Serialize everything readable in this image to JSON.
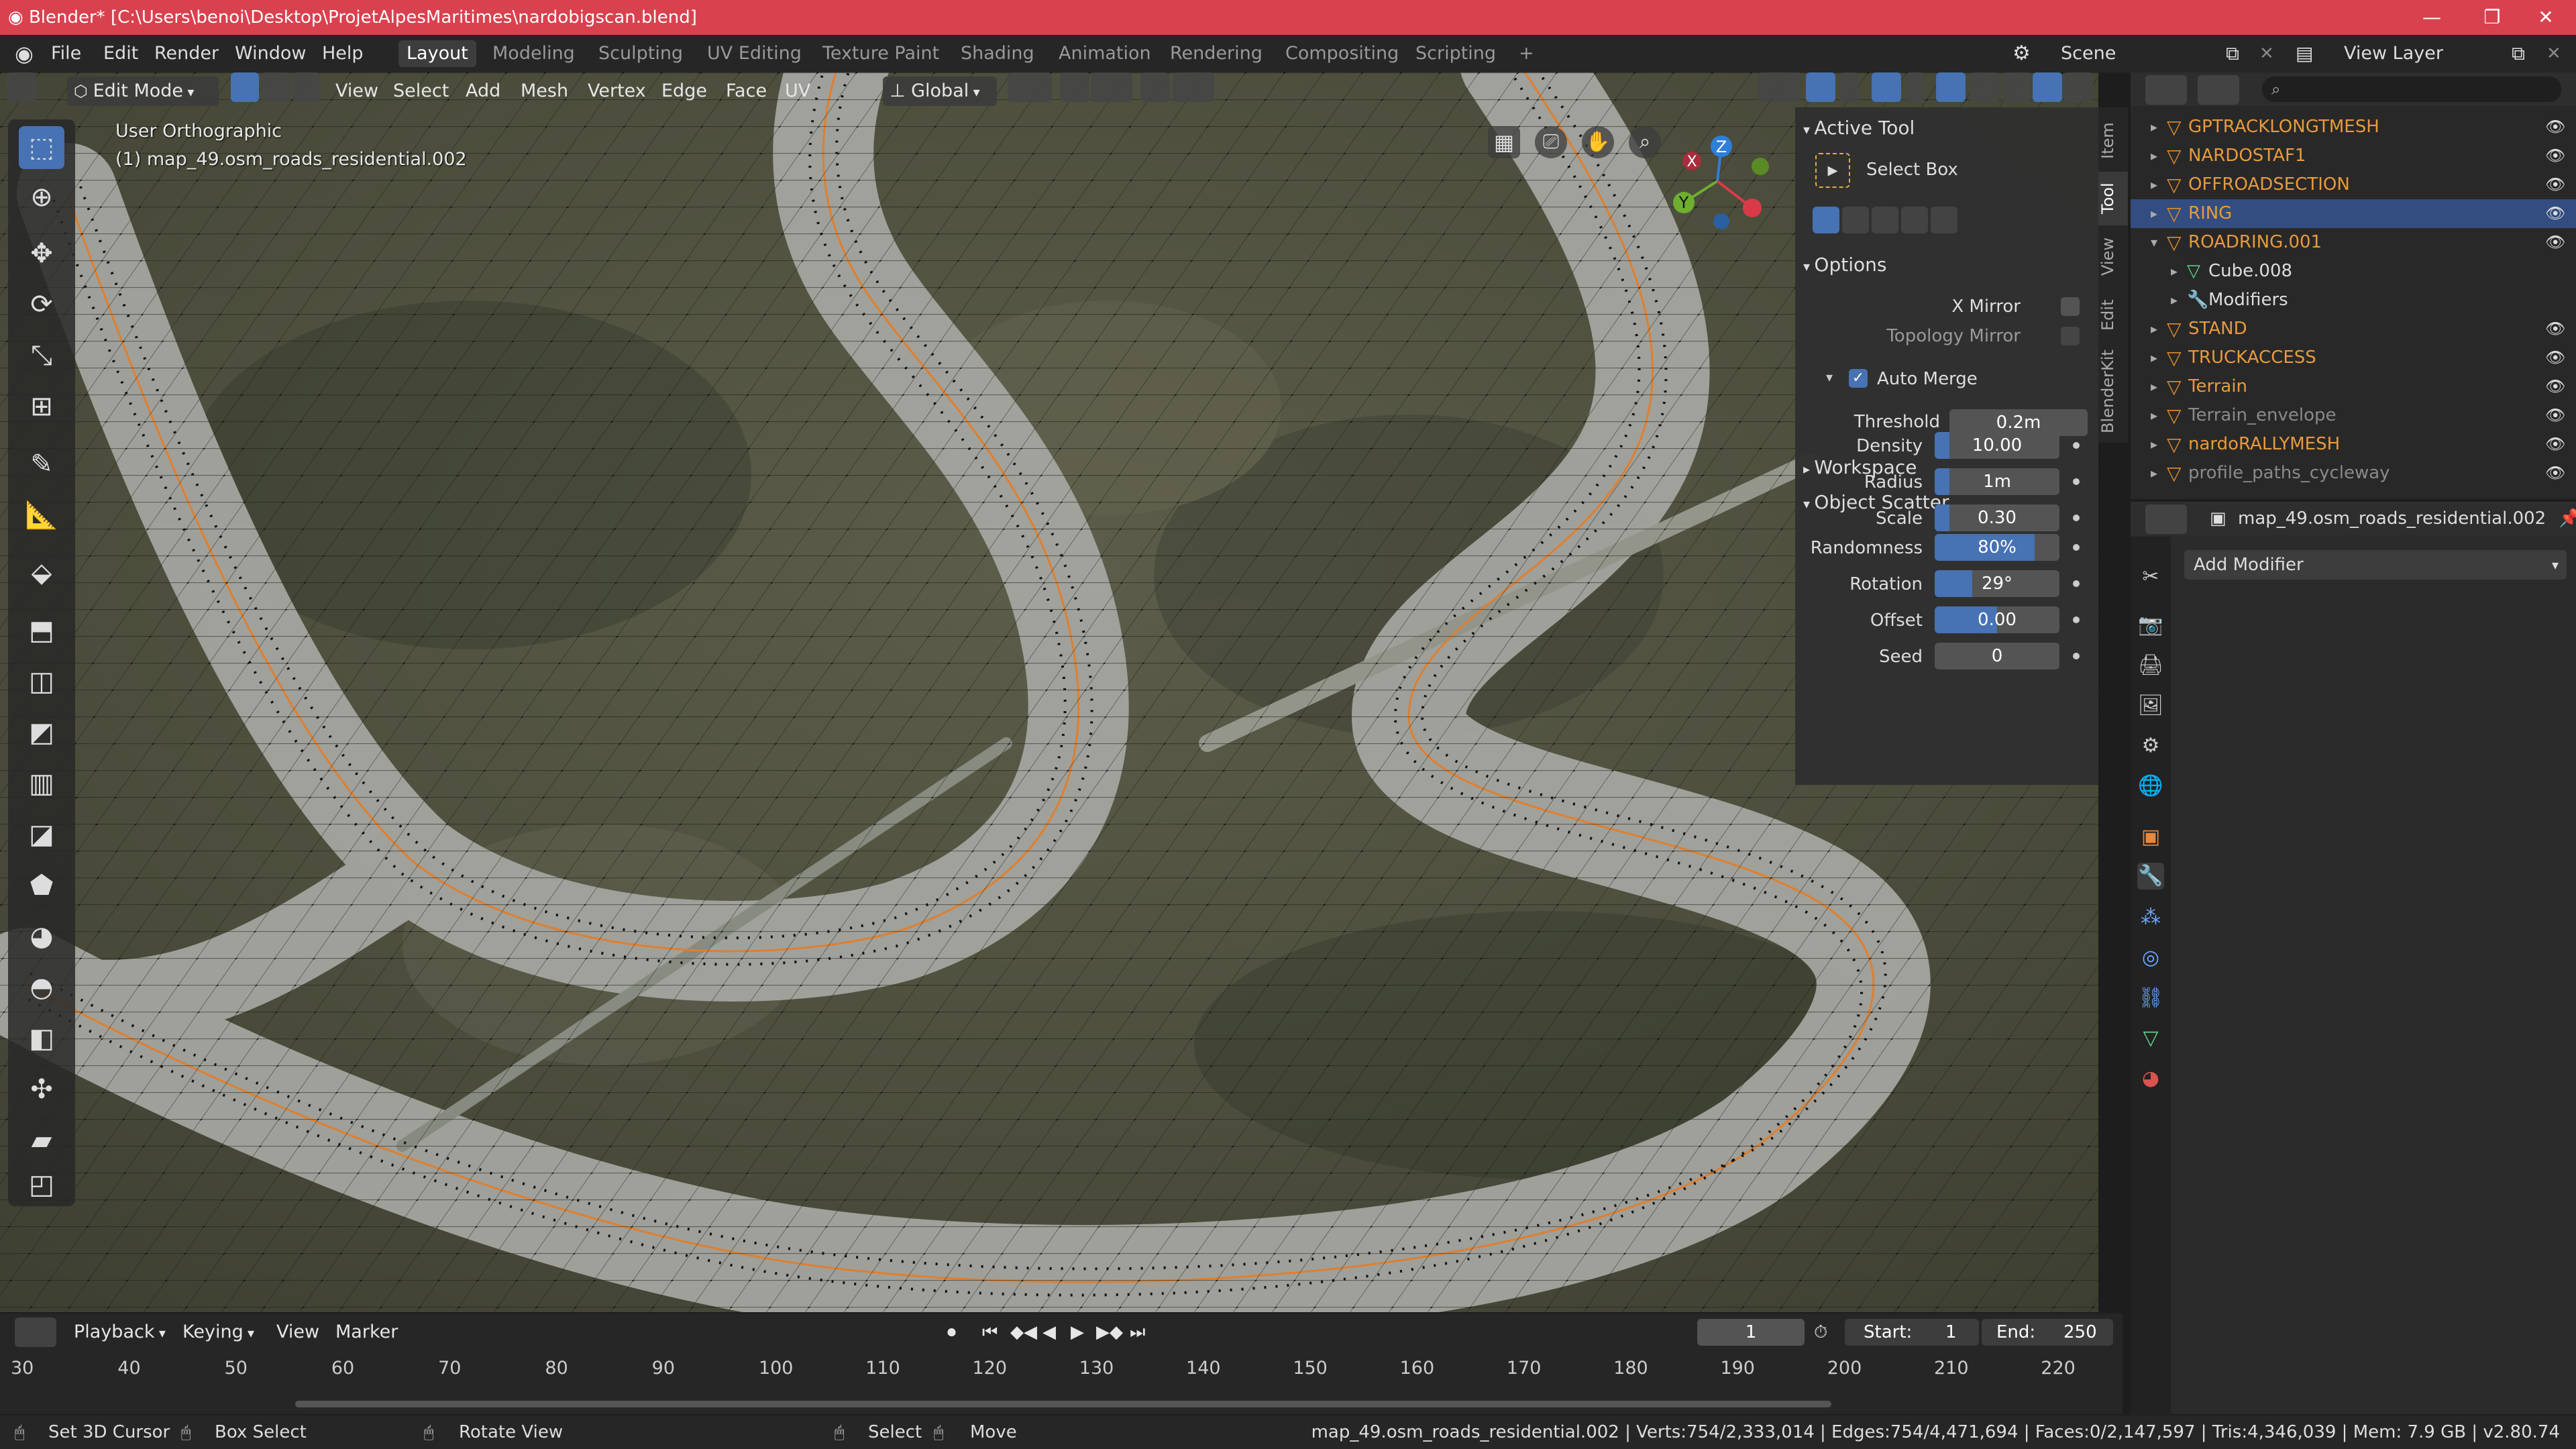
{
  "window": {
    "title": "Blender* [C:\\Users\\benoi\\Desktop\\ProjetAlpesMaritimes\\nardobigscan.blend]",
    "controls": {
      "minimize": "—",
      "maximize": "❐",
      "close": "✕"
    }
  },
  "menu": {
    "items": [
      "File",
      "Edit",
      "Render",
      "Window",
      "Help"
    ],
    "workspaces": [
      "Layout",
      "Modeling",
      "Sculpting",
      "UV Editing",
      "Texture Paint",
      "Shading",
      "Animation",
      "Rendering",
      "Compositing",
      "Scripting"
    ],
    "active_workspace": "Layout",
    "add_tab": "+",
    "scene_label": "Scene",
    "view_layer_label": "View Layer"
  },
  "viewport_header": {
    "mode": "Edit Mode",
    "menus": [
      "View",
      "Select",
      "Add",
      "Mesh",
      "Vertex",
      "Edge",
      "Face",
      "UV"
    ],
    "orientation": "Global"
  },
  "viewport": {
    "view_name": "User Orthographic",
    "object_name": "(1) map_49.osm_roads_residential.002",
    "gizmo": {
      "x": "X",
      "y": "Y",
      "z": "Z"
    }
  },
  "npanel": {
    "tabs": [
      "Item",
      "Tool",
      "View",
      "Edit",
      "BlenderKit"
    ],
    "active_tab": "Tool",
    "active_tool_header": "Active Tool",
    "active_tool_name": "Select Box",
    "options_header": "Options",
    "x_mirror": "X Mirror",
    "topology_mirror": "Topology Mirror",
    "auto_merge": "Auto Merge",
    "threshold_label": "Threshold",
    "threshold_value": "0.2m",
    "workspace_header": "Workspace",
    "scatter_header": "Object Scatter",
    "scatter": [
      {
        "label": "Density",
        "value": "10.00",
        "fill": 0.12
      },
      {
        "label": "Radius",
        "value": "1m",
        "fill": 0.12
      },
      {
        "label": "Scale",
        "value": "0.30",
        "fill": 0.12
      },
      {
        "label": "Randomness",
        "value": "80%",
        "fill": 0.8
      },
      {
        "label": "Rotation",
        "value": "29°",
        "fill": 0.3
      },
      {
        "label": "Offset",
        "value": "0.00",
        "fill": 0.5
      },
      {
        "label": "Seed",
        "value": "0",
        "fill": 0
      }
    ]
  },
  "outliner": {
    "rows": [
      {
        "name": "GPTRACKLONGTMESH",
        "color": "#e89a3c",
        "selected": false,
        "indent": 0
      },
      {
        "name": "NARDOSTAF1",
        "color": "#e89a3c",
        "selected": false,
        "indent": 0
      },
      {
        "name": "OFFROADSECTION",
        "color": "#e89a3c",
        "selected": false,
        "indent": 0
      },
      {
        "name": "RING",
        "color": "#e89a3c",
        "selected": true,
        "indent": 0
      },
      {
        "name": "ROADRING.001",
        "color": "#e89a3c",
        "selected": false,
        "indent": 0
      },
      {
        "name": "Cube.008",
        "color": "#dddddd",
        "selected": false,
        "indent": 1
      },
      {
        "name": "Modifiers",
        "color": "#dddddd",
        "selected": false,
        "indent": 1
      },
      {
        "name": "STAND",
        "color": "#e89a3c",
        "selected": false,
        "indent": 0
      },
      {
        "name": "TRUCKACCESS",
        "color": "#e89a3c",
        "selected": false,
        "indent": 0
      },
      {
        "name": "Terrain",
        "color": "#e89a3c",
        "selected": false,
        "indent": 0
      },
      {
        "name": "Terrain_envelope",
        "color": "#8a8a8a",
        "selected": false,
        "indent": 0
      },
      {
        "name": "nardoRALLYMESH",
        "color": "#e89a3c",
        "selected": false,
        "indent": 0
      },
      {
        "name": "profile_paths_cycleway",
        "color": "#8a8a8a",
        "selected": false,
        "indent": 0
      }
    ]
  },
  "properties": {
    "object_name": "map_49.osm_roads_residential.002",
    "add_modifier": "Add Modifier"
  },
  "timeline": {
    "menus": [
      "Playback",
      "Keying",
      "View",
      "Marker"
    ],
    "current_frame": "1",
    "start_label": "Start:",
    "start_value": "1",
    "end_label": "End:",
    "end_value": "250",
    "ticks": [
      "30",
      "40",
      "50",
      "60",
      "70",
      "80",
      "90",
      "100",
      "110",
      "120",
      "130",
      "140",
      "150",
      "160",
      "170",
      "180",
      "190",
      "200",
      "210",
      "220"
    ]
  },
  "status": {
    "hint1": "Set 3D Cursor",
    "hint2": "Box Select",
    "hint3": "Rotate View",
    "hint4": "Select",
    "hint5": "Move",
    "stats": "map_49.osm_roads_residential.002 | Verts:754/2,333,014 | Edges:754/4,471,694 | Faces:0/2,147,597 | Tris:4,346,039 | Mem: 7.9 GB | v2.80.74"
  }
}
